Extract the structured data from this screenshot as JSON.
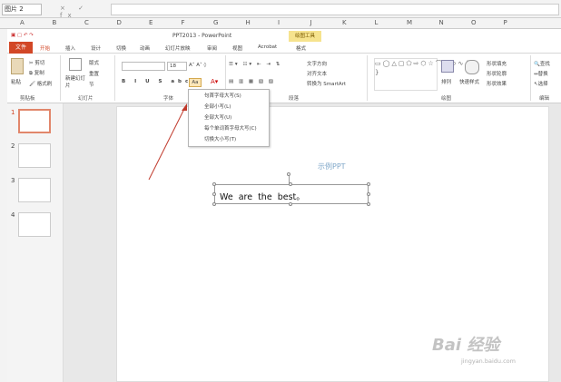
{
  "excel": {
    "namebox": "图片 2",
    "formula_icons": "× ✓ fx",
    "columns": [
      "A",
      "B",
      "C",
      "D",
      "E",
      "F",
      "G",
      "H",
      "I",
      "J",
      "K",
      "L",
      "M",
      "N",
      "O",
      "P"
    ]
  },
  "ppt": {
    "title": "PPT2013 - PowerPoint",
    "context_tab": "绘图工具",
    "tabs": [
      "文件",
      "开始",
      "插入",
      "设计",
      "切换",
      "动画",
      "幻灯片放映",
      "审阅",
      "视图",
      "Acrobat",
      "格式"
    ],
    "ribbon": {
      "clipboard": {
        "paste": "粘贴",
        "cut": "剪切",
        "copy": "复制",
        "format_painter": "格式刷",
        "group": "剪贴板"
      },
      "slides": {
        "new_slide": "新建幻灯片",
        "layout": "版式",
        "reset": "重置",
        "section": "节",
        "group": "幻灯片"
      },
      "font": {
        "size": "18",
        "case_btn": "Aa",
        "group": "字体"
      },
      "paragraph": {
        "text_dir": "文字方向",
        "align_text": "对齐文本",
        "smartart": "转换为 SmartArt",
        "group": "段落"
      },
      "drawing": {
        "arrange": "排列",
        "quick_styles": "快速样式",
        "fill": "形状填充",
        "outline": "形状轮廓",
        "effects": "形状效果",
        "group": "绘图"
      },
      "editing": {
        "find": "查找",
        "replace": "替换",
        "select": "选择",
        "group": "编辑"
      }
    },
    "case_menu": [
      "句首字母大写(S)",
      "全部小写(L)",
      "全部大写(U)",
      "每个单词首字母大写(C)",
      "切换大小写(T)"
    ],
    "slides": [
      "1",
      "2",
      "3",
      "4"
    ],
    "slide": {
      "subtitle": "示例PPT",
      "textbox": "We  are  the  best。"
    }
  },
  "watermark": {
    "text": "Bai 经验",
    "url": "jingyan.baidu.com"
  },
  "colors": {
    "accent": "#d24726",
    "context": "#f6e38e"
  }
}
